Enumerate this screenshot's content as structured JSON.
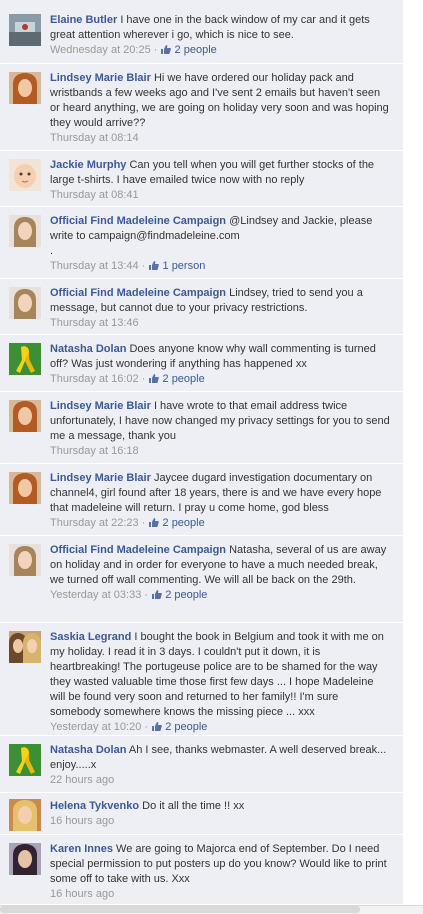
{
  "comments": [
    {
      "author": "Elaine Butler",
      "text": "I have one in the back window of my car and it gets great attention wherever i go, which is nice to see.",
      "time": "Wednesday at 20:25",
      "likes": "2 people",
      "avatar": "car-window-photo"
    },
    {
      "author": "Lindsey Marie Blair",
      "text": "Hi we have ordered our holiday pack and wristbands a few weeks ago and I've sent 2 emails but haven't seen or heard anything, we are going on holiday very soon and was hoping they would arrive??",
      "time": "Thursday at 08:14",
      "likes": "",
      "avatar": "woman-red-hair"
    },
    {
      "author": "Jackie Murphy",
      "text": "Can you tell when you will get further stocks of the large t-shirts. I have emailed twice now with no reply",
      "time": "Thursday at 08:41",
      "likes": "",
      "avatar": "baby-face"
    },
    {
      "author": "Official Find Madeleine Campaign",
      "text": "@Lindsey and Jackie, please write to campaign@findmadeleine.com\n.",
      "time": "Thursday at 13:44",
      "likes": "1 person",
      "avatar": "madeleine-photo"
    },
    {
      "author": "Official Find Madeleine Campaign",
      "text": "Lindsey, tried to send you a message, but cannot due to your privacy restrictions.",
      "time": "Thursday at 13:46",
      "likes": "",
      "avatar": "madeleine-photo"
    },
    {
      "author": "Natasha Dolan",
      "text": "Does anyone know why wall commenting is turned off? Was just wondering if anything has happened xx",
      "time": "Thursday at 16:02",
      "likes": "2 people",
      "avatar": "yellow-ribbon"
    },
    {
      "author": "Lindsey Marie Blair",
      "text": "I have wrote to that email address twice unfortunately, I have now changed my privacy settings for you to send me a message, thank you",
      "time": "Thursday at 16:18",
      "likes": "",
      "avatar": "woman-red-hair"
    },
    {
      "author": "Lindsey Marie Blair",
      "text": "Jaycee dugard investigation documentary on channel4, girl found after 18 years, there is and we have every hope that madeleine will return. I pray u come home, god bless",
      "time": "Thursday at 22:23",
      "likes": "2 people",
      "avatar": "woman-red-hair"
    },
    {
      "author": "Official Find Madeleine Campaign",
      "text": "Natasha, several of us are away on holiday and in order for everyone to have a much needed break, we turned off wall commenting. We will all be back on the 29th.",
      "time": "Yesterday at 03:33",
      "likes": "2 people",
      "avatar": "madeleine-photo"
    },
    {
      "author": "Saskia Legrand",
      "text": "I bought the book in Belgium and took it with me on my holiday. I read it in 3 days. I couldn't put it down, it is heartbreaking! The portugeuse police are to be shamed for the way they wasted valuable time those first few days ... I hope Madeleine will be found very soon and returned to her family!! I'm sure somebody somewhere knows the missing piece ... xxx",
      "time": "Yesterday at 10:20",
      "likes": "2 people",
      "avatar": "two-women"
    },
    {
      "author": "Natasha Dolan",
      "text": "Ah I see, thanks webmaster. A well deserved break... enjoy.....x",
      "time": "22 hours ago",
      "likes": "",
      "avatar": "yellow-ribbon"
    },
    {
      "author": "Helena Tykvenko",
      "text": "Do it all the time !! xx",
      "time": "16 hours ago",
      "likes": "",
      "avatar": "blonde-woman"
    },
    {
      "author": "Karen Innes",
      "text": "We are going to Majorca end of September. Do I need special permission to put posters up do you know? Would like to print some off to take with us. Xxx",
      "time": "16 hours ago",
      "likes": "",
      "avatar": "dark-hair-woman"
    }
  ],
  "colors": {
    "link": "#3b5998",
    "bg": "#edeff4",
    "meta": "#999999"
  }
}
